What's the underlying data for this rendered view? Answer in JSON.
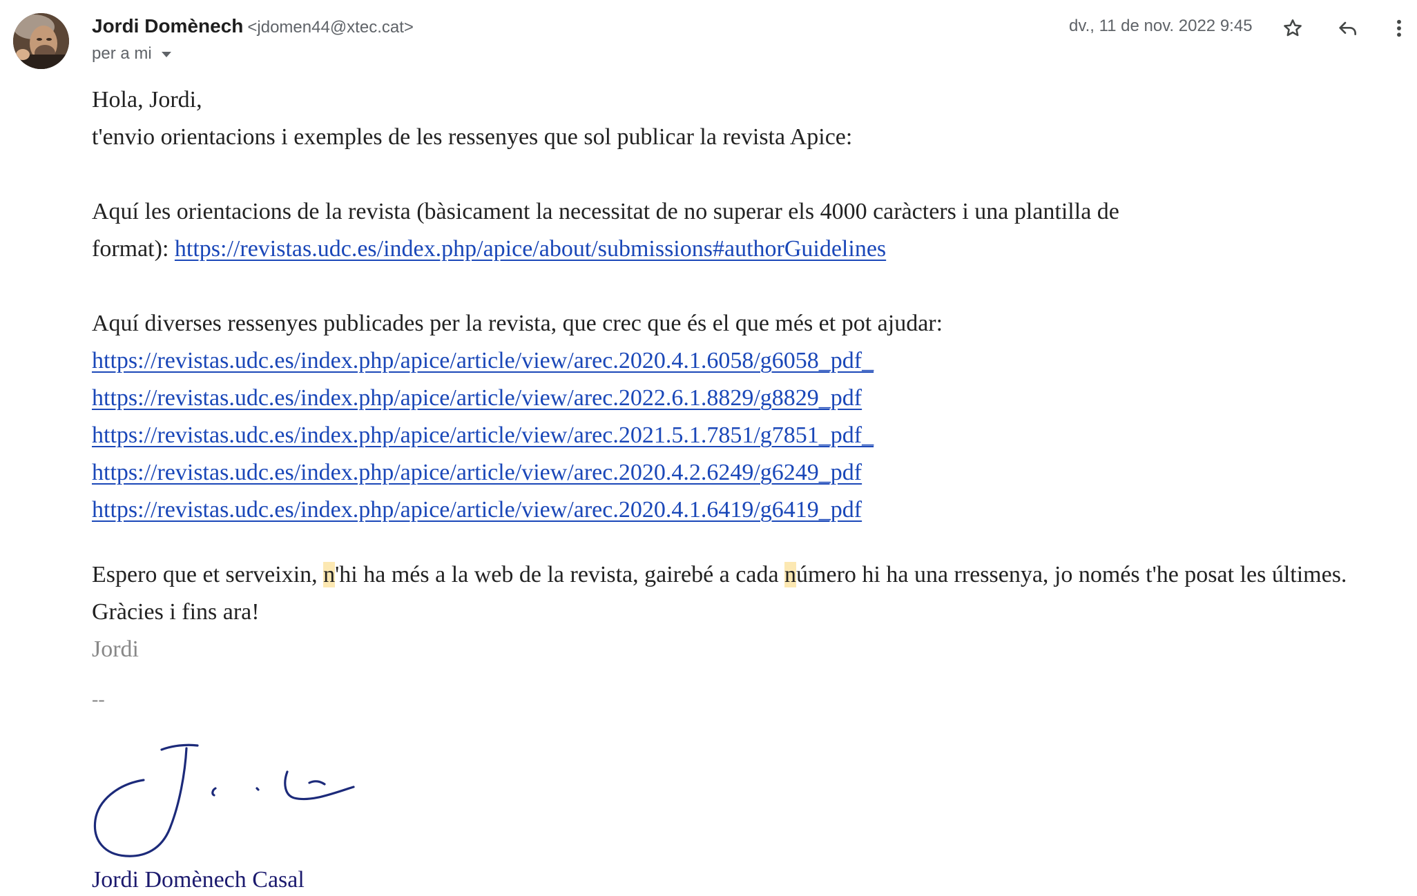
{
  "sender": {
    "name": "Jordi Domènech",
    "email": "<jdomen44@xtec.cat>",
    "recipient": "per a mi",
    "avatar_icon": "person-photo-avatar"
  },
  "header": {
    "date": "dv., 11 de nov. 2022 9:45",
    "icons": [
      "star-icon",
      "reply-icon",
      "more-vert-icon"
    ]
  },
  "email_body": {
    "greeting": "Hola, Jordi,",
    "intro": "t'envio orientacions i exemples de les ressenyes que sol publicar la revista Apice:",
    "guidelines_text_1": "Aquí les orientacions de la revista (bàsicament la necessitat de no superar els 4000 caràcters i una plantilla de",
    "guidelines_text_2": "format): ",
    "guidelines_link": "https://revistas.udc.es/index.php/apice/about/submissions#authorGuidelines",
    "reviews_intro": "Aquí diverses ressenyes publicades per la revista, que crec que és el que més et pot ajudar:",
    "review_links": [
      "https://revistas.udc.es/index.php/apice/article/view/arec.2020.4.1.6058/g6058_pdf_",
      "https://revistas.udc.es/index.php/apice/article/view/arec.2022.6.1.8829/g8829_pdf",
      "https://revistas.udc.es/index.php/apice/article/view/arec.2021.5.1.7851/g7851_pdf_",
      "https://revistas.udc.es/index.php/apice/article/view/arec.2020.4.2.6249/g6249_pdf",
      "https://revistas.udc.es/index.php/apice/article/view/arec.2020.4.1.6419/g6419_pdf"
    ],
    "closing_1_a": "Espero que et serveixin, ",
    "closing_1_hl1": "n",
    "closing_1_b": "'hi ha més a la web de la revista, gairebé a cada ",
    "closing_1_hl2": "n",
    "closing_1_c": "úmero hi ha una rressenya, jo només t'he posat les últimes.",
    "closing_2": "Gràcies i fins ara!",
    "sign_off": "Jordi",
    "separator": "--",
    "signature_full_name": "Jordi Domènech Casal"
  },
  "colors": {
    "link": "#1a47b8",
    "highlight": "#fce8b2",
    "signature_ink": "#1c1a6e",
    "muted": "#5f6368"
  }
}
